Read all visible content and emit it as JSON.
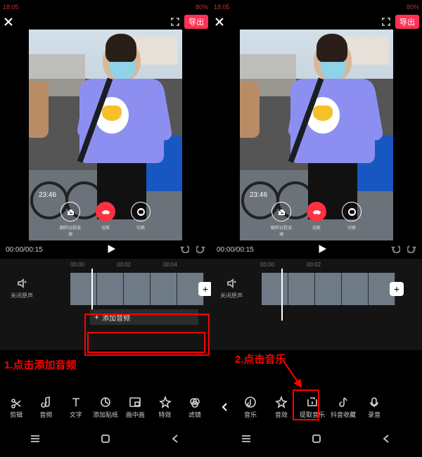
{
  "status_bar": {
    "time": "18:05",
    "battery": "80%"
  },
  "header": {
    "export_label": "导出"
  },
  "call_overlay": {
    "timer": "23:46",
    "share_label": "翻转远程波澜",
    "end_label": "挂断",
    "switch_label": "切换"
  },
  "player": {
    "current": "00:00",
    "total": "00:15"
  },
  "timeline": {
    "ticks": [
      "00:00",
      "00:02",
      "00:04"
    ],
    "ticks2": [
      "00:00",
      "00:02"
    ],
    "mute_label": "关闭原声",
    "add_audio_label": "添加音频"
  },
  "annotations": {
    "step1": "1.点击添加音频",
    "step2": "2.点击音乐"
  },
  "toolbar_main": [
    {
      "icon": "cut",
      "label": "剪辑"
    },
    {
      "icon": "audio",
      "label": "音频"
    },
    {
      "icon": "text",
      "label": "文字"
    },
    {
      "icon": "sticker",
      "label": "添加贴纸"
    },
    {
      "icon": "pip",
      "label": "画中画"
    },
    {
      "icon": "effect",
      "label": "特效"
    },
    {
      "icon": "filter",
      "label": "滤镜"
    }
  ],
  "toolbar_audio": [
    {
      "icon": "music",
      "label": "音乐"
    },
    {
      "icon": "soundfx",
      "label": "音效"
    },
    {
      "icon": "extract",
      "label": "提取音乐"
    },
    {
      "icon": "douyin",
      "label": "抖音收藏"
    },
    {
      "icon": "record",
      "label": "录音"
    }
  ]
}
